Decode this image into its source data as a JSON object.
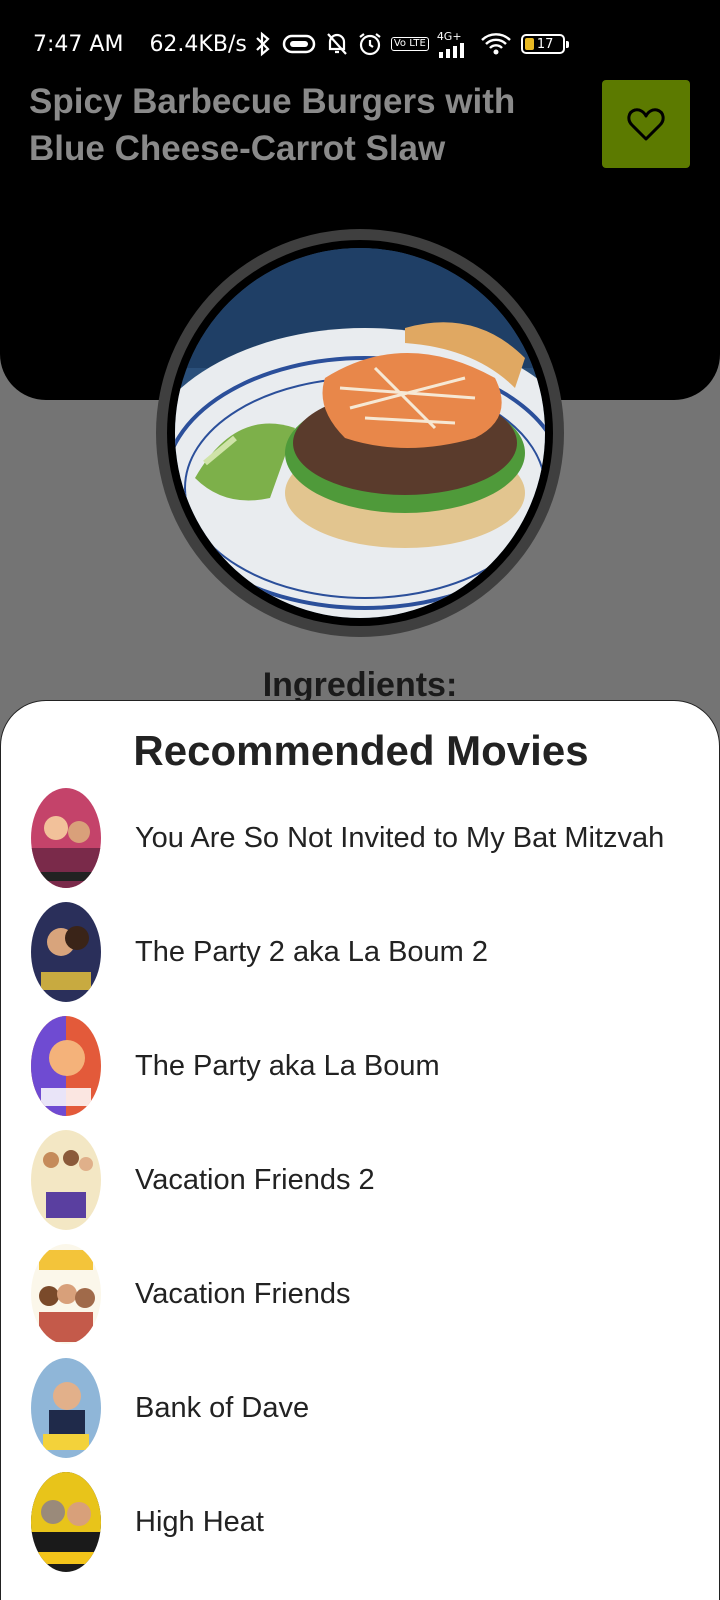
{
  "status_bar": {
    "time": "7:47 AM",
    "speed": "62.4KB/s",
    "network": "4G+",
    "volte": "Vo LTE",
    "battery": "17"
  },
  "recipe": {
    "title": "Spicy Barbecue Burgers with Blue Cheese-Carrot Slaw",
    "favorite_icon": "heart-outline-icon",
    "favorite_color": "#5c7a00",
    "ingredients_heading": "Ingredients:"
  },
  "sheet": {
    "title": "Recommended Movies",
    "movies": [
      {
        "title": "You Are So Not Invited to My Bat Mitzvah"
      },
      {
        "title": "The Party 2 aka La Boum 2"
      },
      {
        "title": "The Party aka La Boum"
      },
      {
        "title": "Vacation Friends 2"
      },
      {
        "title": "Vacation Friends"
      },
      {
        "title": "Bank of Dave"
      },
      {
        "title": "High Heat"
      }
    ]
  }
}
